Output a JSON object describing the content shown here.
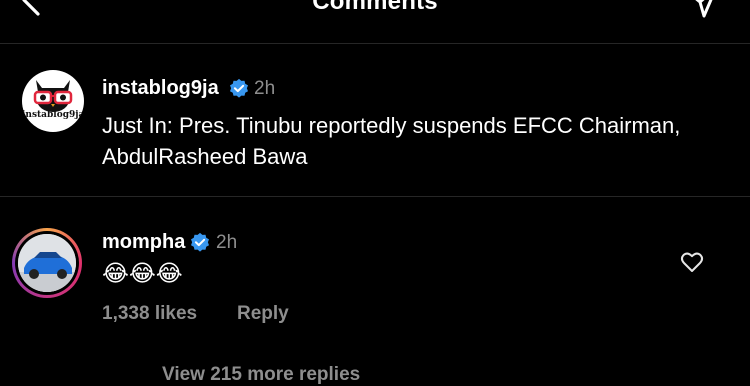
{
  "header": {
    "title": "Comments"
  },
  "post": {
    "username": "instablog9ja",
    "time": "2h",
    "caption": "Just In: Pres. Tinubu reportedly suspends EFCC Chairman, AbdulRasheed Bawa",
    "avatar_brand": "instablog9ja"
  },
  "comment": {
    "username": "mompha",
    "time": "2h",
    "text": "😂😂😂",
    "likes": "1,338 likes",
    "reply_label": "Reply"
  },
  "more_replies": {
    "label": "View 215 more replies"
  },
  "colors": {
    "background": "#000000",
    "muted": "#8e8e8e",
    "verified": "#3897f0",
    "divider": "#262626"
  }
}
